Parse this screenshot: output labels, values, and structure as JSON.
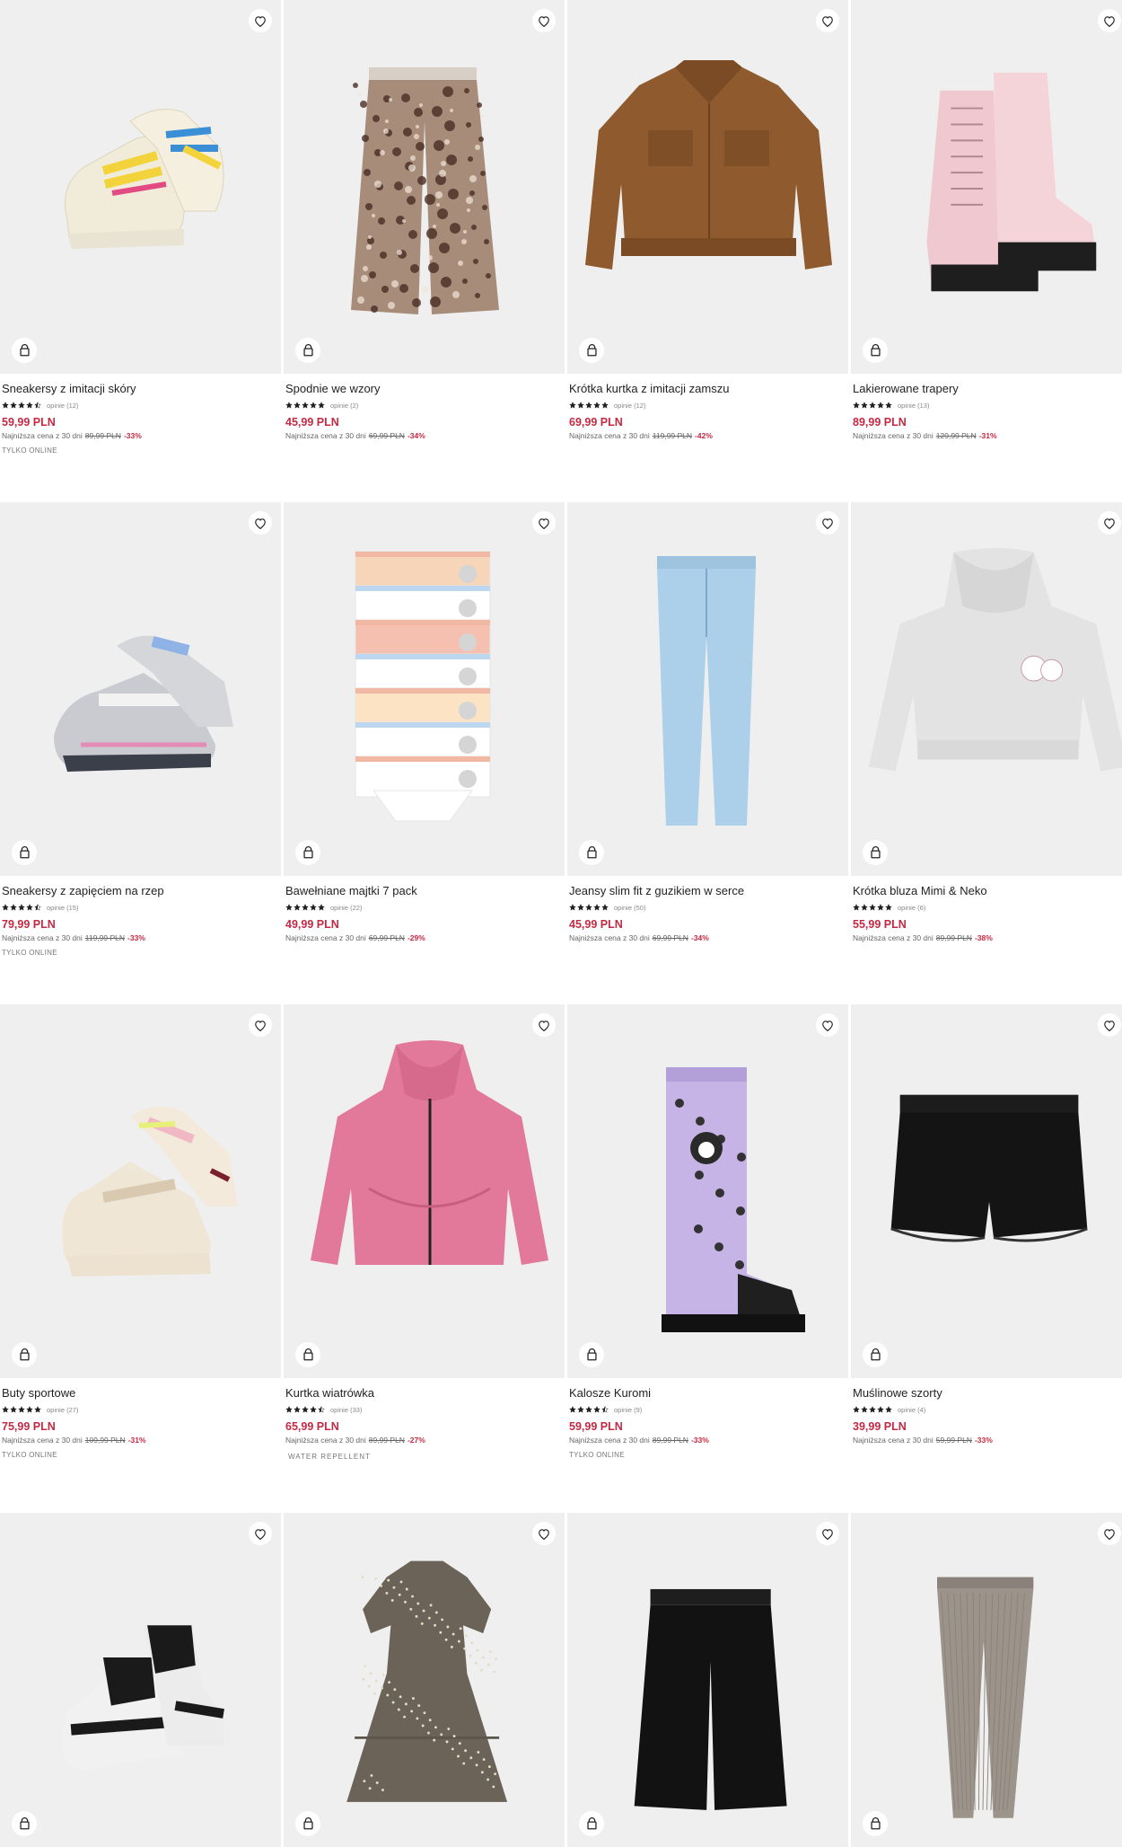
{
  "icons": {
    "favorite": "heart-icon",
    "add_to_bag": "bag-icon",
    "star": "star-icon"
  },
  "colors": {
    "price": "#c42943",
    "card_bg": "#efefef",
    "text": "#222222",
    "muted": "#666666"
  },
  "lowest_label": "Najniższa cena z 30 dni",
  "products": [
    {
      "name": "Sneakersy z imitacji skóry",
      "rating": 4.5,
      "reviews": "opinie (12)",
      "price": "59,99 PLN",
      "old_price": "89,99 PLN",
      "discount": "-33%",
      "tag": "TYLKO ONLINE",
      "art": "sneaker-beige"
    },
    {
      "name": "Spodnie we wzory",
      "rating": 5,
      "reviews": "opinie (2)",
      "price": "45,99 PLN",
      "old_price": "69,99 PLN",
      "discount": "-34%",
      "tag": "",
      "art": "pants-pattern"
    },
    {
      "name": "Krótka kurtka z imitacji zamszu",
      "rating": 5,
      "reviews": "opinie (12)",
      "price": "69,99 PLN",
      "old_price": "119,99 PLN",
      "discount": "-42%",
      "tag": "",
      "art": "jacket-brown"
    },
    {
      "name": "Lakierowane trapery",
      "rating": 5,
      "reviews": "opinie (13)",
      "price": "89,99 PLN",
      "old_price": "129,99 PLN",
      "discount": "-31%",
      "tag": "",
      "art": "boots-pink"
    },
    {
      "name": "Sneakersy z zapięciem na rzep",
      "rating": 4.5,
      "reviews": "opinie (15)",
      "price": "79,99 PLN",
      "old_price": "119,99 PLN",
      "discount": "-33%",
      "tag": "TYLKO ONLINE",
      "art": "sneaker-grey"
    },
    {
      "name": "Bawełniane majtki 7 pack",
      "rating": 5,
      "reviews": "opinie (22)",
      "price": "49,99 PLN",
      "old_price": "69,99 PLN",
      "discount": "-29%",
      "tag": "",
      "art": "briefs"
    },
    {
      "name": "Jeansy slim fit z guzikiem w serce",
      "rating": 5,
      "reviews": "opinie (50)",
      "price": "45,99 PLN",
      "old_price": "69,99 PLN",
      "discount": "-34%",
      "tag": "",
      "art": "jeans"
    },
    {
      "name": "Krótka bluza Mimi & Neko",
      "rating": 5,
      "reviews": "opinie (6)",
      "price": "55,99 PLN",
      "old_price": "89,99 PLN",
      "discount": "-38%",
      "tag": "",
      "art": "hoodie-grey"
    },
    {
      "name": "Buty sportowe",
      "rating": 5,
      "reviews": "opinie (27)",
      "price": "75,99 PLN",
      "old_price": "109,99 PLN",
      "discount": "-31%",
      "tag": "TYLKO ONLINE",
      "art": "sneaker-cream"
    },
    {
      "name": "Kurtka wiatrówka",
      "rating": 4.5,
      "reviews": "opinie (33)",
      "price": "65,99 PLN",
      "old_price": "89,99 PLN",
      "discount": "-27%",
      "tag": "WATER REPELLENT",
      "art": "windbreaker-pink"
    },
    {
      "name": "Kalosze Kuromi",
      "rating": 4.5,
      "reviews": "opinie (9)",
      "price": "59,99 PLN",
      "old_price": "89,99 PLN",
      "discount": "-33%",
      "tag": "TYLKO ONLINE",
      "art": "rainboot"
    },
    {
      "name": "Muślinowe szorty",
      "rating": 5,
      "reviews": "opinie (4)",
      "price": "39,99 PLN",
      "old_price": "59,99 PLN",
      "discount": "-33%",
      "tag": "",
      "art": "shorts-black"
    },
    {
      "name": "",
      "art": "hightop-bw"
    },
    {
      "name": "",
      "art": "dress-floral"
    },
    {
      "name": "",
      "art": "culottes-black"
    },
    {
      "name": "",
      "art": "leggings-grey"
    }
  ]
}
